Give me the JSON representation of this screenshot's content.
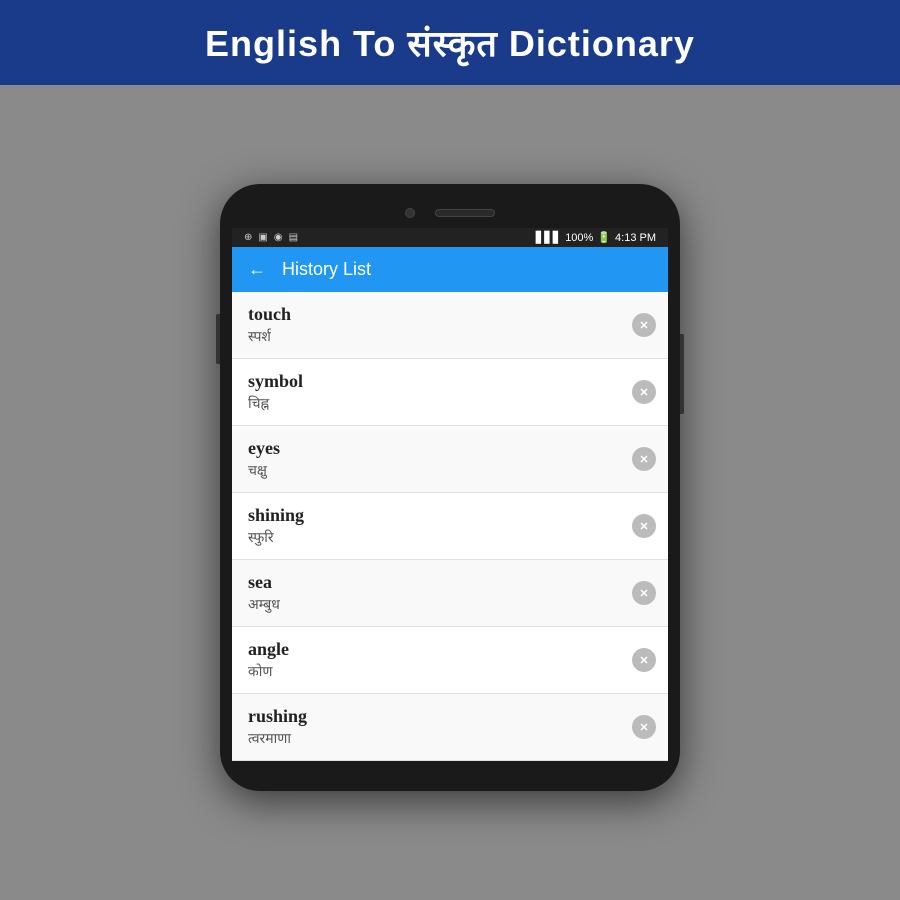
{
  "banner": {
    "title": "English To संस्कृत Dictionary"
  },
  "statusBar": {
    "time": "4:13 PM",
    "battery": "100%",
    "icons": [
      "⊕",
      "▣",
      "◉",
      "▤"
    ]
  },
  "appBar": {
    "title": "History List",
    "backArrow": "←"
  },
  "historyItems": [
    {
      "english": "touch",
      "sanskrit": "स्पर्श"
    },
    {
      "english": "symbol",
      "sanskrit": "चिह्न"
    },
    {
      "english": "eyes",
      "sanskrit": "चक्षु"
    },
    {
      "english": "shining",
      "sanskrit": "स्फुरि"
    },
    {
      "english": "sea",
      "sanskrit": "अम्बुध"
    },
    {
      "english": "angle",
      "sanskrit": "कोण"
    },
    {
      "english": "rushing",
      "sanskrit": "त्वरमाणा"
    }
  ]
}
